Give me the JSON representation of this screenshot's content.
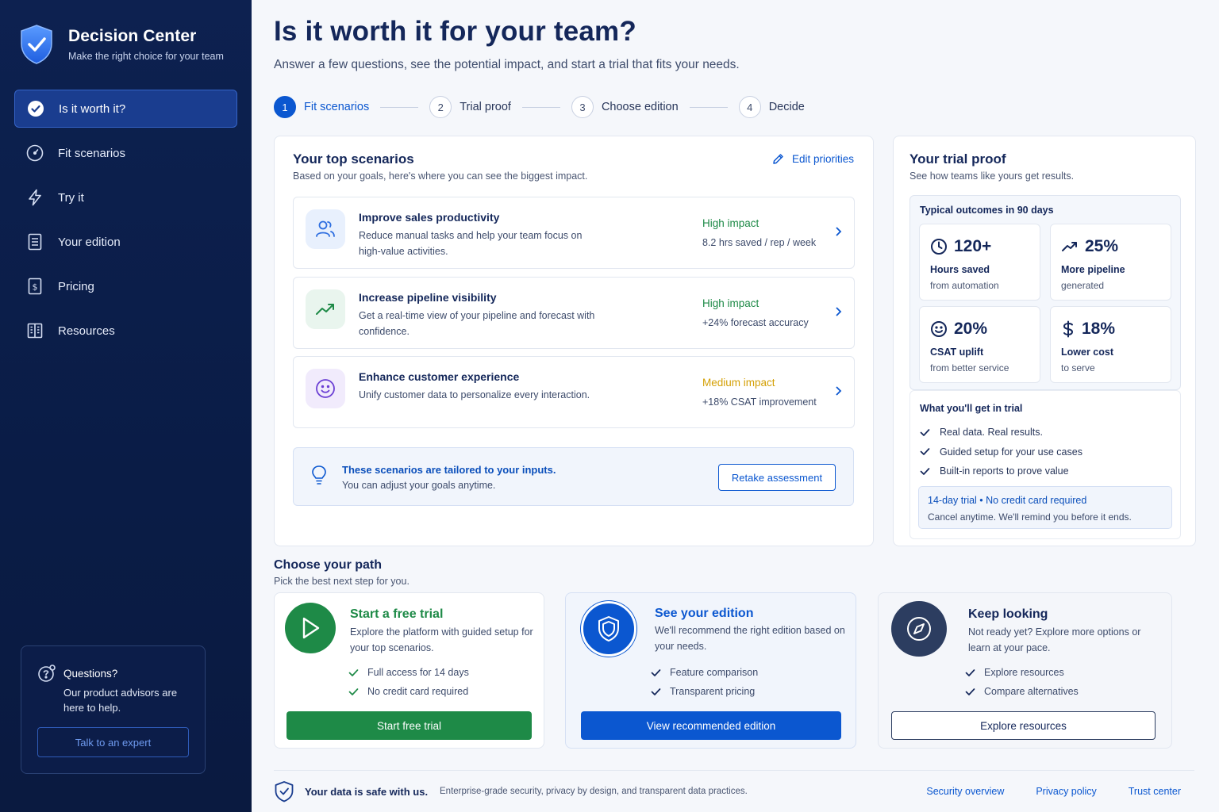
{
  "sidebar": {
    "brand_title": "Decision Center",
    "brand_sub": "Make the right choice for your team",
    "items": [
      {
        "label": "Is it worth it?",
        "icon": "check-circle-icon",
        "active": true
      },
      {
        "label": "Fit scenarios",
        "icon": "gauge-icon"
      },
      {
        "label": "Try it",
        "icon": "bolt-icon"
      },
      {
        "label": "Your edition",
        "icon": "document-icon"
      },
      {
        "label": "Pricing",
        "icon": "dollar-doc-icon"
      },
      {
        "label": "Resources",
        "icon": "building-icon"
      }
    ],
    "help": {
      "title": "Questions?",
      "text": "Our product advisors are here to help.",
      "button": "Talk to an expert"
    }
  },
  "header": {
    "title": "Is it worth it for your team?",
    "subtitle": "Answer a few questions, see the potential impact, and start a trial that fits your needs."
  },
  "steps": [
    {
      "num": "1",
      "label": "Fit scenarios",
      "active": true
    },
    {
      "num": "2",
      "label": "Trial proof"
    },
    {
      "num": "3",
      "label": "Choose edition"
    },
    {
      "num": "4",
      "label": "Decide"
    }
  ],
  "scenarios": {
    "title": "Your top scenarios",
    "subtitle": "Based on your goals, here's where you can see the biggest impact.",
    "edit_label": "Edit priorities",
    "items": [
      {
        "name": "Improve sales productivity",
        "desc": "Reduce manual tasks and help your team focus on high-value activities.",
        "impact": "High impact",
        "metric": "8.2 hrs saved / rep / week",
        "icon": "users-icon"
      },
      {
        "name": "Increase pipeline visibility",
        "desc": "Get a real-time view of your pipeline and forecast with confidence.",
        "impact": "High impact",
        "metric": "+24% forecast accuracy",
        "icon": "trend-up-icon"
      },
      {
        "name": "Enhance customer experience",
        "desc": "Unify customer data to personalize every interaction.",
        "impact": "Medium impact",
        "metric": "+18% CSAT improvement",
        "icon": "smile-icon"
      }
    ],
    "tip_title": "These scenarios are tailored to your inputs.",
    "tip_text": "You can adjust your goals anytime.",
    "tip_button": "Retake assessment"
  },
  "trial_proof": {
    "title": "Your trial proof",
    "subtitle": "See how teams like yours get results.",
    "outcomes_title": "Typical outcomes in 90 days",
    "stats": [
      {
        "value": "120+",
        "label": "Hours saved",
        "sub": "from automation",
        "icon": "clock-icon"
      },
      {
        "value": "25%",
        "label": "More pipeline",
        "sub": "generated",
        "icon": "trend-up-icon"
      },
      {
        "value": "20%",
        "label": "CSAT uplift",
        "sub": "from better service",
        "icon": "smile-icon"
      },
      {
        "value": "18%",
        "label": "Lower cost",
        "sub": "to serve",
        "icon": "dollar-icon"
      }
    ],
    "get_title": "What you'll get in trial",
    "get_items": [
      "Real data. Real results.",
      "Guided setup for your use cases",
      "Built-in reports to prove value"
    ],
    "note_line1": "14-day trial • No credit card required",
    "note_line2": "Cancel anytime. We'll remind you before it ends."
  },
  "path": {
    "title": "Choose your path",
    "subtitle": "Pick the best next step for you.",
    "cards": [
      {
        "title": "Start a free trial",
        "desc": "Explore the platform with guided setup for your top scenarios.",
        "items": [
          "Full access for 14 days",
          "No credit card required"
        ],
        "button": "Start free trial",
        "icon": "play-icon"
      },
      {
        "title": "See your edition",
        "desc": "We'll recommend the right edition based on your needs.",
        "items": [
          "Feature comparison",
          "Transparent pricing"
        ],
        "button": "View recommended edition",
        "icon": "shield-icon"
      },
      {
        "title": "Keep looking",
        "desc": "Not ready yet? Explore more options or learn at your pace.",
        "items": [
          "Explore resources",
          "Compare alternatives"
        ],
        "button": "Explore resources",
        "icon": "compass-icon"
      }
    ]
  },
  "footer": {
    "title": "Your data is safe with us.",
    "text": "Enterprise-grade security, privacy by design, and transparent data practices.",
    "links": [
      "Security overview",
      "Privacy policy",
      "Trust center"
    ]
  },
  "colors": {
    "primary": "#0b57d0",
    "success": "#1e8a47",
    "warning": "#d4a006",
    "sidebar": "#0d2150"
  }
}
